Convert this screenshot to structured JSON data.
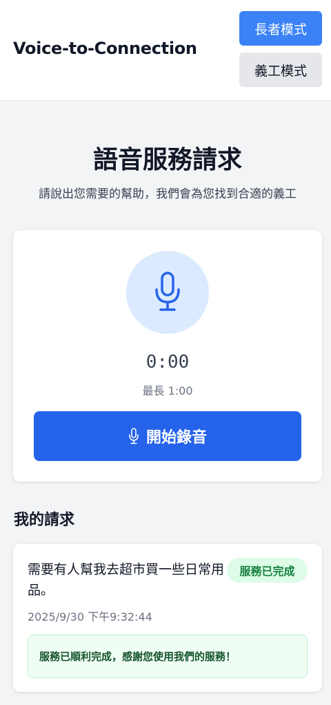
{
  "header": {
    "brand": "Voice-to-Connection",
    "elder_mode_label": "長者模式",
    "volunteer_mode_label": "義工模式"
  },
  "main": {
    "title": "語音服務請求",
    "subtitle": "請說出您需要的幫助，我們會為您找到合適的義工"
  },
  "recorder": {
    "timer": "0:00",
    "max_length": "最長 1:00",
    "start_label": "開始錄音",
    "mic_icon": "microphone-icon"
  },
  "requests": {
    "section_title": "我的請求",
    "items": [
      {
        "text": "需要有人幫我去超市買一些日常用品。",
        "status": "服務已完成",
        "time": "2025/9/30 下午9:32:44",
        "notice": "服務已順利完成，感謝您使用我們的服務！"
      }
    ]
  },
  "colors": {
    "primary": "#2563eb",
    "elder_mode": "#3b82f6",
    "mic_bg": "#dbeafe",
    "status_green_bg": "#dcfce7",
    "status_green_text": "#15803d"
  }
}
